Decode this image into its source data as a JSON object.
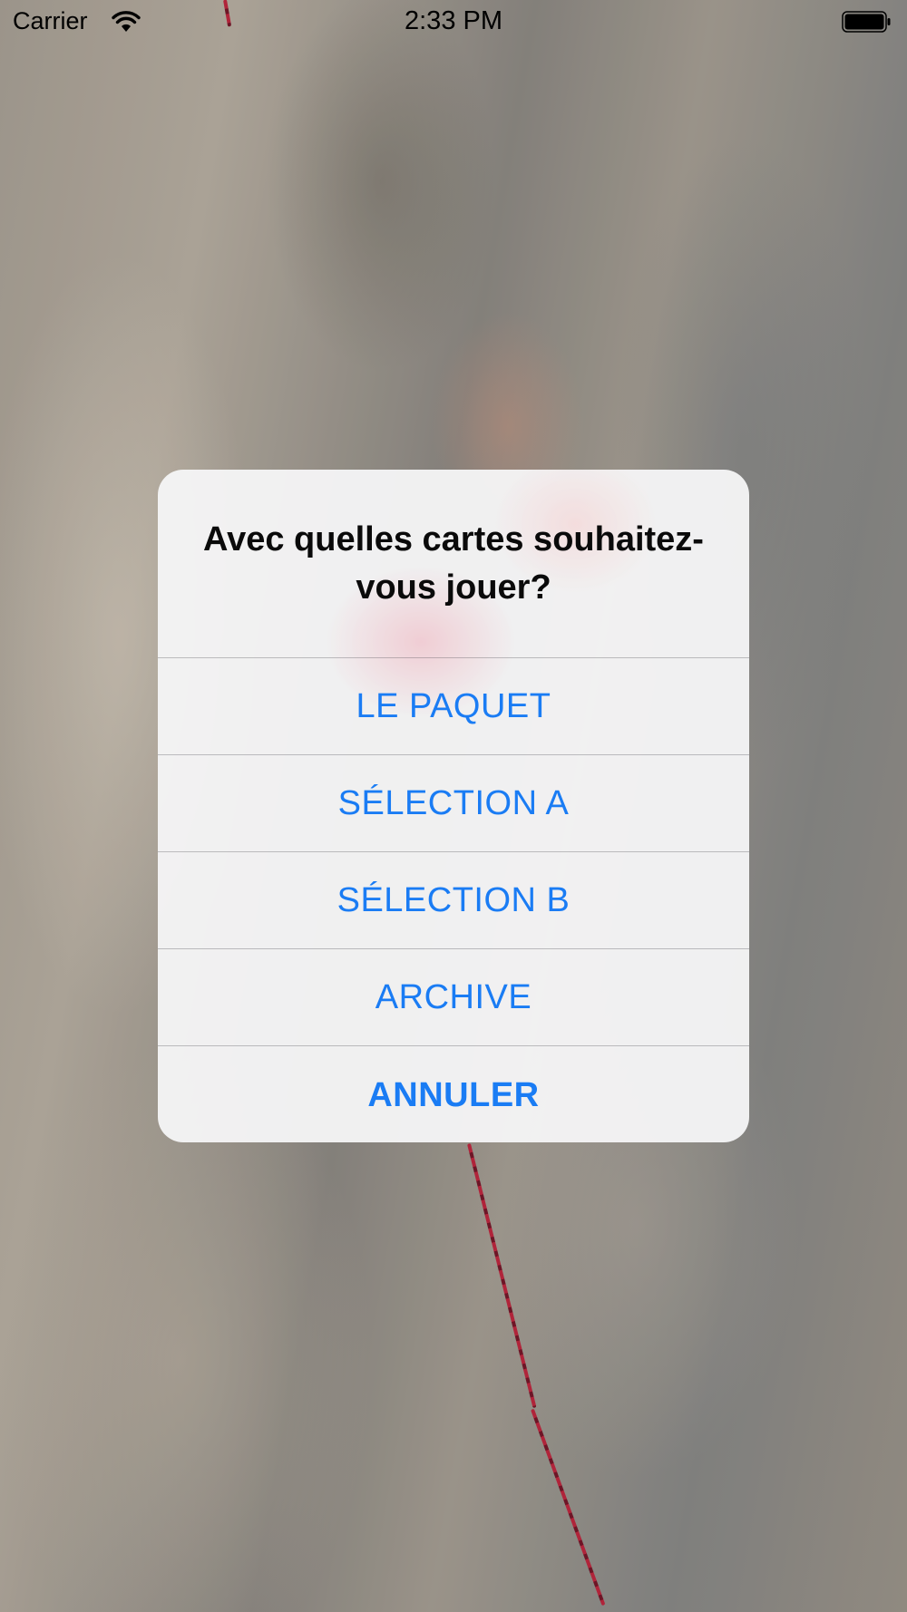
{
  "status_bar": {
    "carrier": "Carrier",
    "time": "2:33 PM",
    "wifi_icon": "wifi-icon",
    "battery_icon": "battery-full-icon"
  },
  "background": {
    "description_icon": "rock-climber-photo"
  },
  "alert": {
    "title": "Avec quelles cartes souhaitez-vous jouer?",
    "actions": [
      {
        "label": "LE PAQUET",
        "style": "default"
      },
      {
        "label": "SÉLECTION A",
        "style": "default"
      },
      {
        "label": "SÉLECTION B",
        "style": "default"
      },
      {
        "label": "ARCHIVE",
        "style": "default"
      },
      {
        "label": "ANNULER",
        "style": "cancel"
      }
    ],
    "accent_color": "#1a7cf4"
  }
}
